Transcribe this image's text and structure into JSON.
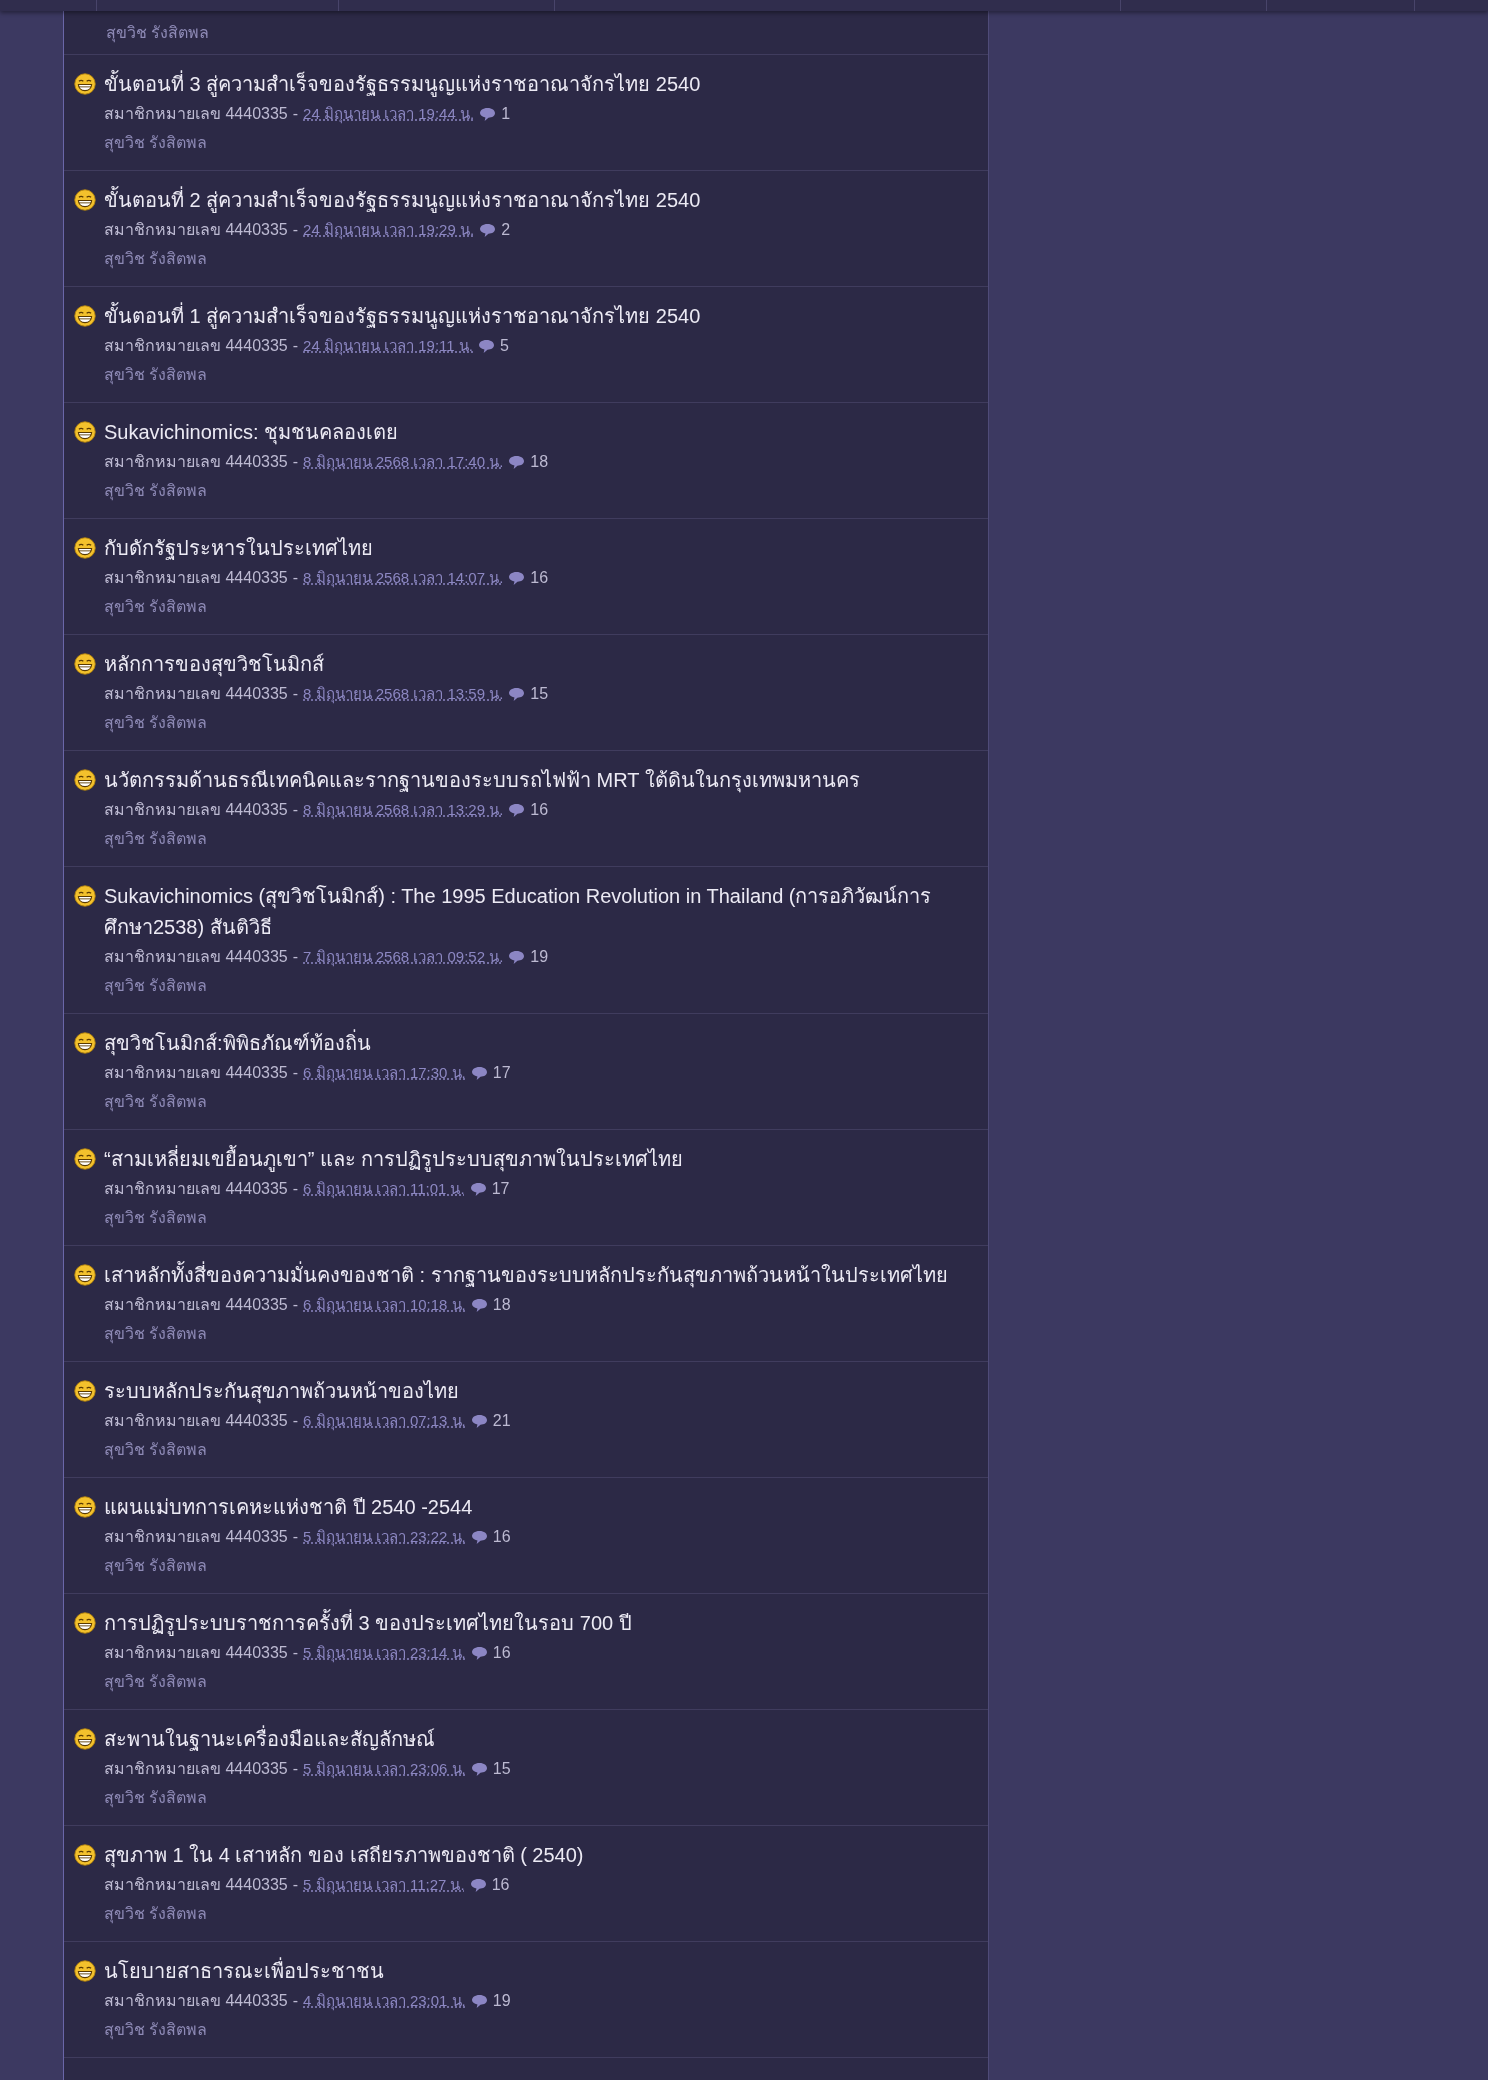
{
  "topics": [
    {
      "kind": "partial",
      "tag": "สุขวิช รังสิตพล"
    },
    {
      "kind": "full",
      "title": "ขั้นตอนที่ 3 สู่ความสำเร็จของรัฐธรรมนูญแห่งราชอาณาจักรไทย 2540",
      "author": "สมาชิกหมายเลข 4440335",
      "separator": "-",
      "date": "24 มิถุนายน เวลา 19:44 น.",
      "comments": "1",
      "tag": "สุขวิช รังสิตพล"
    },
    {
      "kind": "full",
      "title": "ขั้นตอนที่ 2 สู่ความสำเร็จของรัฐธรรมนูญแห่งราชอาณาจักรไทย 2540",
      "author": "สมาชิกหมายเลข 4440335",
      "separator": "-",
      "date": "24 มิถุนายน เวลา 19:29 น.",
      "comments": "2",
      "tag": "สุขวิช รังสิตพล"
    },
    {
      "kind": "full",
      "title": "ขั้นตอนที่ 1 สู่ความสำเร็จของรัฐธรรมนูญแห่งราชอาณาจักรไทย 2540",
      "author": "สมาชิกหมายเลข 4440335",
      "separator": "-",
      "date": "24 มิถุนายน เวลา 19:11 น.",
      "comments": "5",
      "tag": "สุขวิช รังสิตพล"
    },
    {
      "kind": "full",
      "title": "Sukavichinomics: ชุมชนคลองเตย",
      "author": "สมาชิกหมายเลข 4440335",
      "separator": "-",
      "date": "8 มิถุนายน 2568 เวลา 17:40 น.",
      "comments": "18",
      "tag": "สุขวิช รังสิตพล"
    },
    {
      "kind": "full",
      "title": "กับดักรัฐประหารในประเทศไทย",
      "author": "สมาชิกหมายเลข 4440335",
      "separator": "-",
      "date": "8 มิถุนายน 2568 เวลา 14:07 น.",
      "comments": "16",
      "tag": "สุขวิช รังสิตพล"
    },
    {
      "kind": "full",
      "title": "หลักการของสุขวิชโนมิกส์",
      "author": "สมาชิกหมายเลข 4440335",
      "separator": "-",
      "date": "8 มิถุนายน 2568 เวลา 13:59 น.",
      "comments": "15",
      "tag": "สุขวิช รังสิตพล"
    },
    {
      "kind": "full",
      "title": "นวัตกรรมด้านธรณีเทคนิคและรากฐานของระบบรถไฟฟ้า MRT ใต้ดินในกรุงเทพมหานคร",
      "author": "สมาชิกหมายเลข 4440335",
      "separator": "-",
      "date": "8 มิถุนายน 2568 เวลา 13:29 น.",
      "comments": "16",
      "tag": "สุขวิช รังสิตพล"
    },
    {
      "kind": "full",
      "title": "Sukavichinomics (สุขวิชโนมิกส์) : The 1995 Education Revolution in Thailand (การอภิวัฒน์การศึกษา2538) สันติวิธี",
      "author": "สมาชิกหมายเลข 4440335",
      "separator": "-",
      "date": "7 มิถุนายน 2568 เวลา 09:52 น.",
      "comments": "19",
      "tag": "สุขวิช รังสิตพล"
    },
    {
      "kind": "full",
      "title": "สุขวิชโนมิกส์:พิพิธภัณฑ์ท้องถิ่น",
      "author": "สมาชิกหมายเลข 4440335",
      "separator": "-",
      "date": "6 มิถุนายน เวลา 17:30 น.",
      "comments": "17",
      "tag": "สุขวิช รังสิตพล"
    },
    {
      "kind": "full",
      "title": "“สามเหลี่ยมเขยื้อนภูเขา” และ การปฏิรูประบบสุขภาพในประเทศไทย",
      "author": "สมาชิกหมายเลข 4440335",
      "separator": "-",
      "date": "6 มิถุนายน เวลา 11:01 น.",
      "comments": "17",
      "tag": "สุขวิช รังสิตพล"
    },
    {
      "kind": "full",
      "title": "เสาหลักทั้งสี่ของความมั่นคงของชาติ : รากฐานของระบบหลักประกันสุขภาพถ้วนหน้าในประเทศไทย",
      "author": "สมาชิกหมายเลข 4440335",
      "separator": "-",
      "date": "6 มิถุนายน เวลา 10:18 น.",
      "comments": "18",
      "tag": "สุขวิช รังสิตพล"
    },
    {
      "kind": "full",
      "title": "ระบบหลักประกันสุขภาพถ้วนหน้าของไทย",
      "author": "สมาชิกหมายเลข 4440335",
      "separator": "-",
      "date": "6 มิถุนายน เวลา 07:13 น.",
      "comments": "21",
      "tag": "สุขวิช รังสิตพล"
    },
    {
      "kind": "full",
      "title": "แผนแม่บทการเคหะแห่งชาติ ปี 2540 -2544",
      "author": "สมาชิกหมายเลข 4440335",
      "separator": "-",
      "date": "5 มิถุนายน เวลา 23:22 น.",
      "comments": "16",
      "tag": "สุขวิช รังสิตพล"
    },
    {
      "kind": "full",
      "title": "การปฏิรูประบบราชการครั้งที่ 3 ของประเทศไทยในรอบ 700 ปี",
      "author": "สมาชิกหมายเลข 4440335",
      "separator": "-",
      "date": "5 มิถุนายน เวลา 23:14 น.",
      "comments": "16",
      "tag": "สุขวิช รังสิตพล"
    },
    {
      "kind": "full",
      "title": "สะพานในฐานะเครื่องมือและสัญลักษณ์",
      "author": "สมาชิกหมายเลข 4440335",
      "separator": "-",
      "date": "5 มิถุนายน เวลา 23:06 น.",
      "comments": "15",
      "tag": "สุขวิช รังสิตพล"
    },
    {
      "kind": "full",
      "title": "สุขภาพ 1 ใน 4 เสาหลัก ของ เสถียรภาพของชาติ ( 2540)",
      "author": "สมาชิกหมายเลข 4440335",
      "separator": "-",
      "date": "5 มิถุนายน เวลา 11:27 น.",
      "comments": "16",
      "tag": "สุขวิช รังสิตพล"
    },
    {
      "kind": "full",
      "title": "นโยบายสาธารณะเพื่อประชาชน",
      "author": "สมาชิกหมายเลข 4440335",
      "separator": "-",
      "date": "4 มิถุนายน เวลา 23:01 น.",
      "comments": "19",
      "tag": "สุขวิช รังสิตพล"
    }
  ]
}
